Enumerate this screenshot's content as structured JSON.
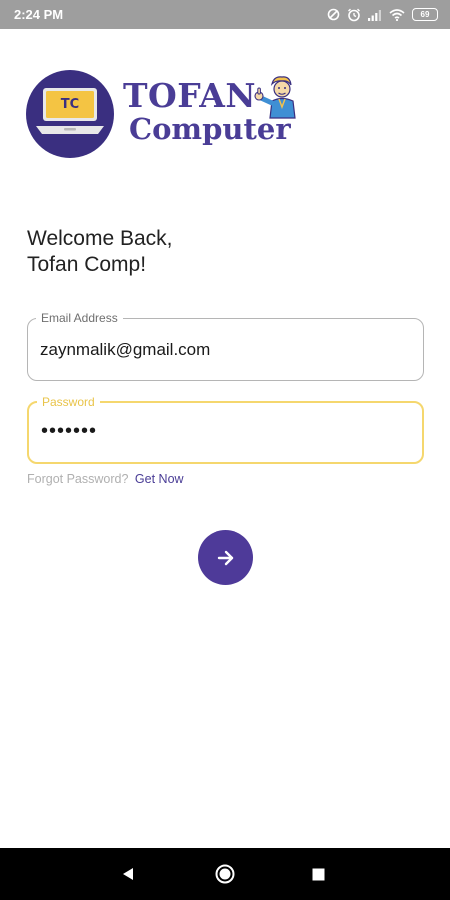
{
  "status_bar": {
    "time": "2:24 PM",
    "battery": "69",
    "icons": [
      "data-saver-icon",
      "alarm-icon",
      "signal-icon",
      "wifi-icon",
      "battery-icon"
    ]
  },
  "logo": {
    "badge": "TC",
    "word_1": "TOFAN",
    "word_2": "Computer"
  },
  "greeting": {
    "line_1": "Welcome Back,",
    "line_2": "Tofan Comp!"
  },
  "form": {
    "email_label": "Email Address",
    "email_value": "zaynmalik@gmail.com",
    "password_label": "Password",
    "password_value": "•••••••",
    "forgot_text": "Forgot Password?",
    "forgot_link": "Get Now",
    "submit_icon": "arrow-right-icon"
  },
  "nav_bar": {
    "icons": [
      "back-icon",
      "home-icon",
      "recents-icon"
    ]
  },
  "colors": {
    "brand": "#4a3d96",
    "brand_dark": "#3a2f80",
    "focus_border": "#f5d76e",
    "status_bar": "#9e9e9e",
    "nav_bar": "#000000"
  }
}
